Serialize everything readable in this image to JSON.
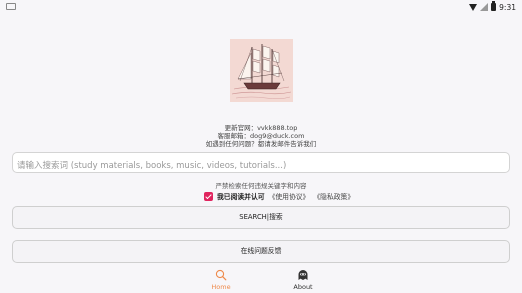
{
  "status_bar": {
    "time": "9:31"
  },
  "info": {
    "website_line": "更新官网：vvkk888.top",
    "email_line": "客服邮箱：dog9@duck.com",
    "help_line": "如遇到任何问题？都请发邮件告诉我们"
  },
  "search": {
    "placeholder": "请输入搜索词 (study materials, books, music, videos, tutorials...)",
    "value": ""
  },
  "warning": "严禁检索任何违规关键字和内容",
  "agreement": {
    "checked": true,
    "text": "我已阅读并认可",
    "terms_link": "《使用协议》",
    "privacy_link": "《隐私政策》"
  },
  "buttons": {
    "search": "SEARCH|搜索",
    "feedback": "在线问题反馈"
  },
  "nav": {
    "items": [
      {
        "label": "Home",
        "icon": "search-icon",
        "active": true
      },
      {
        "label": "About",
        "icon": "ghost-icon",
        "active": false
      }
    ]
  },
  "colors": {
    "accent": "#e0245e",
    "nav_active": "#ef8a4b",
    "background": "#f7f6f9"
  }
}
